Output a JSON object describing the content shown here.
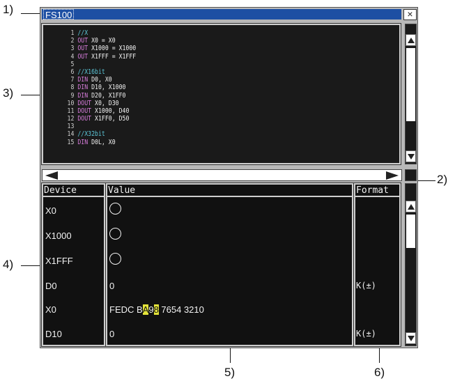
{
  "callouts": {
    "c1": "1)",
    "c2": "2)",
    "c3": "3)",
    "c4": "4)",
    "c5": "5)",
    "c6": "6)"
  },
  "window": {
    "title": "FS100",
    "close_glyph": "×"
  },
  "code": {
    "lines": [
      {
        "num": "1",
        "kw": "",
        "text": "",
        "comment": "//X"
      },
      {
        "num": "2",
        "kw": "OUT",
        "text": " X0 = X0",
        "comment": ""
      },
      {
        "num": "3",
        "kw": "OUT",
        "text": " X1000 = X1000",
        "comment": ""
      },
      {
        "num": "4",
        "kw": "OUT",
        "text": " X1FFF = X1FFF",
        "comment": ""
      },
      {
        "num": "5",
        "kw": "",
        "text": "",
        "comment": ""
      },
      {
        "num": "6",
        "kw": "",
        "text": "",
        "comment": "//X16bit"
      },
      {
        "num": "7",
        "kw": "DIN",
        "text": " D0, X0",
        "comment": ""
      },
      {
        "num": "8",
        "kw": "DIN",
        "text": " D10, X1000",
        "comment": ""
      },
      {
        "num": "9",
        "kw": "DIN",
        "text": " D20, X1FF0",
        "comment": ""
      },
      {
        "num": "10",
        "kw": "DOUT",
        "text": " X0, D30",
        "comment": ""
      },
      {
        "num": "11",
        "kw": "DOUT",
        "text": " X1000, D40",
        "comment": ""
      },
      {
        "num": "12",
        "kw": "DOUT",
        "text": " X1FF0, D50",
        "comment": ""
      },
      {
        "num": "13",
        "kw": "",
        "text": "",
        "comment": ""
      },
      {
        "num": "14",
        "kw": "",
        "text": "",
        "comment": "//X32bit"
      },
      {
        "num": "15",
        "kw": "DIN",
        "text": " D0L, X0",
        "comment": ""
      }
    ]
  },
  "monitor": {
    "headers": {
      "device": "Device",
      "value": "Value",
      "format": "Format"
    },
    "rows": [
      {
        "device": "X0",
        "value": "",
        "value_type": "bit-on",
        "format": ""
      },
      {
        "device": "X1000",
        "value": "",
        "value_type": "bit-on",
        "format": ""
      },
      {
        "device": "X1FFF",
        "value": "",
        "value_type": "bit-on",
        "format": ""
      },
      {
        "device": "D0",
        "value": "0",
        "value_type": "text",
        "format": "K(±)"
      },
      {
        "device": "X0",
        "value_pre": "FEDC B",
        "value_hl1": "A",
        "value_mid": "9",
        "value_hl2": "8",
        "value_post": " 7654 3210",
        "value_type": "hex",
        "format": ""
      },
      {
        "device": "D10",
        "value": "0",
        "value_type": "text",
        "format": "K(±)"
      }
    ]
  },
  "colors": {
    "titlebar": "#1d4fa3",
    "panel_bg": "#1a1a1a",
    "keyword": "#d57bd9",
    "comment": "#5cc6d8",
    "highlight": "#e3e33a"
  }
}
